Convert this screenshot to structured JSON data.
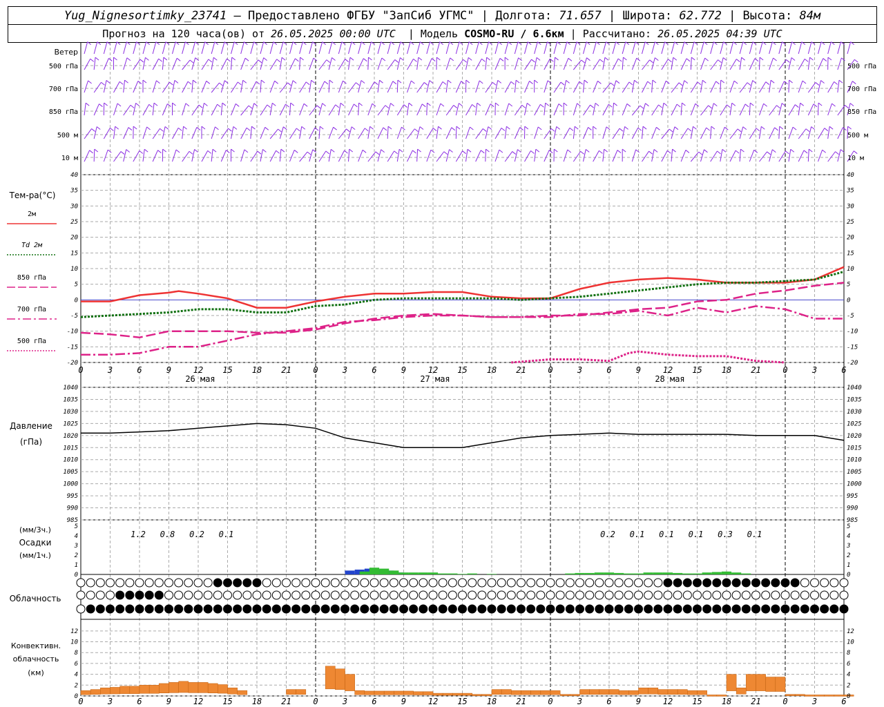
{
  "header": {
    "station": "Yug_Nignesortimky_23741",
    "dash": "—",
    "provider": "Предоставлено ФГБУ \"ЗапСиб УГМС\"",
    "lon_label": "Долгота:",
    "lon": "71.657",
    "lat_label": "Широта:",
    "lat": "62.772",
    "alt_label": "Высота:",
    "alt": "84м",
    "forecast_prefix": "Прогноз на 120 часа(ов) от",
    "forecast_time": "26.05.2025 00:00 UTC",
    "model_label": "Модель",
    "model": "COSMO-RU / 6.6км",
    "calc_label": "Рассчитано:",
    "calc_time": "26.05.2025 04:39 UTC"
  },
  "colors": {
    "wind": "#8a2be2",
    "t2m": "#ee3333",
    "td2m": "#107010",
    "t850": "#dd2288",
    "t700": "#dd2288",
    "t500": "#dd2288",
    "pressure": "#000000",
    "precip3h": "#2244cc",
    "precip1h": "#33bb33",
    "convective": "#ee8833",
    "grid": "#aaaaaa"
  },
  "x_axis": {
    "hour_labels": [
      "0",
      "3",
      "6",
      "9",
      "12",
      "15",
      "18",
      "21",
      "0",
      "3",
      "6",
      "9",
      "12",
      "15",
      "18",
      "21",
      "0",
      "3",
      "6",
      "9",
      "12",
      "15",
      "18",
      "21",
      "0",
      "3",
      "6"
    ],
    "date_labels": [
      "26 мая",
      "27 мая",
      "28 мая"
    ]
  },
  "wind_panel": {
    "title": "Ветер",
    "levels": [
      "500 гПа",
      "700 гПа",
      "850 гПа",
      "500 м",
      "10  м"
    ],
    "levels_right": [
      "500 гПа",
      "700 гПа",
      "850 гПа",
      "500 м",
      "10  м"
    ]
  },
  "temp_panel": {
    "title": "Тем-ра(°C)",
    "legend": [
      "2м",
      "Td  2м",
      "850 гПа",
      "700 гПа",
      "500 гПа"
    ],
    "y_ticks": [
      "40",
      "35",
      "30",
      "25",
      "20",
      "15",
      "10",
      "5",
      "0",
      "-5",
      "-10",
      "-15",
      "-20"
    ]
  },
  "pressure_panel": {
    "title": "Давление",
    "unit": "(гПа)",
    "y_ticks": [
      "1040",
      "1035",
      "1030",
      "1025",
      "1020",
      "1015",
      "1010",
      "1005",
      "1000",
      "995",
      "990",
      "985"
    ]
  },
  "precip_panel": {
    "unit3h": "(мм/3ч.)",
    "title": "Осадки",
    "unit1h": "(мм/1ч.)",
    "y_ticks": [
      "5",
      "4",
      "3",
      "2",
      "1",
      "0"
    ],
    "totals": [
      {
        "hour": 6,
        "value": "1.2"
      },
      {
        "hour": 9,
        "value": "0.8"
      },
      {
        "hour": 12,
        "value": "0.2"
      },
      {
        "hour": 15,
        "value": "0.1"
      },
      {
        "hour": 54,
        "value": "0.2"
      },
      {
        "hour": 57,
        "value": "0.1"
      },
      {
        "hour": 60,
        "value": "0.1"
      },
      {
        "hour": 63,
        "value": "0.1"
      },
      {
        "hour": 66,
        "value": "0.3"
      },
      {
        "hour": 69,
        "value": "0.1"
      }
    ]
  },
  "cloud_panel": {
    "title": "Облачность",
    "rows": [
      "000000000000000000000000000000000000000000888888888888800000000000000000000000000000000000000000000000000000000000000000000000000000000000000000000000000000000000000000000000000008888888888888888888888888888888888888888888000000000000000000000",
      "00000000000888888888888880000000000000000000000000000000000000000000000000000000000000000000000000000000000000000000000000000000000000000000000000000000000000000000000000000000000000000000000000000000000000000000000000000000000000000000000000",
      "00088888888888888888888888888888888888888888888888888888888888888888888888888888888888888888888888888888888888888888888888888888888888888888888888888888888888888888888888888888888888888888888888888888888888888888888888888888888888888888888888"
    ]
  },
  "conv_panel": {
    "title1": "Конвективн.",
    "title2": "облачность",
    "unit": "(км)",
    "y_ticks": [
      "12",
      "10",
      "8",
      "6",
      "4",
      "2",
      "0"
    ]
  },
  "chart_data": [
    {
      "type": "line",
      "name": "temperature",
      "x_unit": "hours from 26.05.2025 00:00 UTC",
      "ylim": [
        -20,
        40
      ],
      "series": [
        {
          "name": "2м",
          "x": [
            0,
            3,
            6,
            9,
            10,
            12,
            15,
            18,
            21,
            24,
            27,
            30,
            33,
            36,
            39,
            42,
            45,
            48,
            51,
            54,
            57,
            60,
            63,
            66,
            69,
            72,
            75,
            78
          ],
          "y": [
            -0.5,
            -0.5,
            1.5,
            2.3,
            2.8,
            2,
            0.5,
            -2.5,
            -2.5,
            -0.5,
            1,
            2,
            2,
            2.5,
            2.5,
            1,
            0.5,
            0.5,
            3.5,
            5.5,
            6.5,
            7,
            6.5,
            5.5,
            5.5,
            5.5,
            6.5,
            10.5
          ]
        },
        {
          "name": "Td  2м",
          "x": [
            0,
            3,
            6,
            9,
            12,
            15,
            18,
            21,
            24,
            27,
            30,
            33,
            36,
            39,
            42,
            45,
            48,
            51,
            54,
            57,
            60,
            63,
            66,
            69,
            72,
            75,
            78
          ],
          "y": [
            -5.5,
            -5,
            -4.5,
            -4,
            -3,
            -3,
            -4,
            -4,
            -2,
            -1.5,
            0,
            0.5,
            0.5,
            0.5,
            0.5,
            0,
            0.5,
            1,
            2,
            3,
            4,
            5,
            5.5,
            5.5,
            6,
            6.5,
            9
          ]
        },
        {
          "name": "850 гПа",
          "x": [
            0,
            3,
            6,
            9,
            12,
            15,
            18,
            21,
            24,
            27,
            30,
            33,
            36,
            39,
            42,
            45,
            48,
            51,
            54,
            57,
            60,
            63,
            66,
            69,
            72,
            75,
            78
          ],
          "y": [
            -10.5,
            -11,
            -12,
            -10,
            -10,
            -10,
            -10.5,
            -10.5,
            -9.5,
            -7.5,
            -6,
            -5,
            -4.5,
            -5,
            -5.5,
            -5.5,
            -5,
            -5,
            -4,
            -3,
            -2.5,
            -0.5,
            0,
            2,
            3,
            4.5,
            5.5
          ]
        },
        {
          "name": "700 гПа",
          "x": [
            0,
            3,
            6,
            9,
            12,
            15,
            18,
            21,
            24,
            27,
            30,
            33,
            36,
            39,
            42,
            45,
            48,
            51,
            54,
            57,
            60,
            63,
            66,
            69,
            72,
            75,
            78
          ],
          "y": [
            -17.5,
            -17.5,
            -17,
            -15,
            -15,
            -13,
            -11,
            -10,
            -9,
            -7,
            -6.5,
            -5.5,
            -5,
            -5,
            -5.5,
            -5.5,
            -5.5,
            -4.5,
            -4.5,
            -3.5,
            -5,
            -2.5,
            -4,
            -2,
            -3,
            -6,
            -6
          ]
        },
        {
          "name": "500 гПа",
          "x": [
            44,
            48,
            51,
            54,
            56,
            57,
            60,
            63,
            66,
            69,
            72
          ],
          "y": [
            -20,
            -19,
            -19,
            -19.5,
            -17,
            -16.5,
            -17.5,
            -18,
            -18,
            -19.5,
            -20
          ]
        }
      ]
    },
    {
      "type": "line",
      "name": "pressure",
      "ylim": [
        985,
        1040
      ],
      "series": [
        {
          "name": "Давление",
          "x": [
            0,
            3,
            6,
            9,
            12,
            15,
            18,
            21,
            24,
            27,
            30,
            33,
            36,
            39,
            42,
            45,
            48,
            51,
            54,
            57,
            60,
            63,
            66,
            69,
            72,
            75,
            78
          ],
          "y": [
            1021,
            1021,
            1021.5,
            1022,
            1023,
            1024,
            1025,
            1024.5,
            1023,
            1019,
            1017,
            1015,
            1015,
            1015,
            1017,
            1019,
            1020,
            1020.5,
            1021,
            1020.5,
            1020.5,
            1020.5,
            1020.5,
            1020,
            1020,
            1020,
            1018
          ]
        }
      ]
    },
    {
      "type": "bar",
      "name": "precipitation",
      "ylim": [
        0,
        5
      ],
      "series": [
        {
          "name": "(мм/3ч.)",
          "x": [
            27.5,
            28.5,
            29.5,
            30.5,
            31.5,
            32.5
          ],
          "y": [
            0.4,
            0.5,
            0.6,
            0.5,
            0.4,
            0.2
          ]
        },
        {
          "name": "(мм/1ч.)",
          "x": [
            29,
            30,
            31,
            32,
            33,
            34,
            35,
            36,
            37,
            38,
            39,
            40,
            42,
            50,
            51,
            52,
            53,
            54,
            55,
            56,
            57,
            58,
            59,
            60,
            61,
            62,
            63,
            64,
            65,
            66,
            67,
            68
          ],
          "y": [
            0.3,
            0.7,
            0.6,
            0.4,
            0.2,
            0.2,
            0.2,
            0.2,
            0.1,
            0.1,
            0.05,
            0.1,
            0.05,
            0.1,
            0.15,
            0.15,
            0.2,
            0.2,
            0.15,
            0.1,
            0.1,
            0.2,
            0.2,
            0.2,
            0.15,
            0.1,
            0.1,
            0.2,
            0.25,
            0.3,
            0.2,
            0.1
          ]
        }
      ]
    },
    {
      "type": "bar",
      "name": "convective cloud",
      "ylim": [
        0,
        13
      ],
      "series": [
        {
          "name": "(км)",
          "x": [
            0,
            1,
            2,
            3,
            4,
            5,
            6,
            7,
            8,
            9,
            10,
            11,
            12,
            13,
            14,
            15,
            16,
            17,
            18,
            19,
            20,
            21,
            22,
            23,
            24,
            25,
            26,
            27,
            28,
            29,
            30,
            31,
            32,
            33,
            34,
            35,
            36,
            37,
            38,
            39,
            40,
            41,
            42,
            43,
            44,
            45,
            46,
            47,
            48,
            49,
            50,
            51,
            52,
            53,
            54,
            55,
            56,
            57,
            58,
            59,
            60,
            61,
            62,
            63,
            64,
            65,
            66,
            67,
            68,
            69,
            70,
            71,
            72,
            73,
            74,
            75,
            76,
            77,
            78
          ],
          "y": [
            1,
            1.2,
            1.5,
            1.6,
            1.8,
            1.8,
            2,
            2,
            2.3,
            2.5,
            2.7,
            2.5,
            2.5,
            2.3,
            2.1,
            1.5,
            1,
            0,
            0,
            0,
            0,
            1.2,
            1.2,
            0,
            0,
            5.5,
            5,
            4,
            1,
            0.9,
            0.9,
            0.9,
            0.9,
            0.9,
            0.8,
            0.8,
            0.5,
            0.5,
            0.5,
            0.5,
            0.3,
            0.3,
            1.2,
            1.2,
            1,
            1,
            1,
            1,
            1,
            0.3,
            0.3,
            1.2,
            1.2,
            1.2,
            1.2,
            1,
            1,
            1.5,
            1.5,
            1.2,
            1.2,
            1.2,
            1,
            1,
            0.2,
            0.2,
            4,
            1.5,
            4,
            4,
            3.5,
            3.5,
            0.3,
            0.3,
            0.2,
            0.2,
            0.2,
            0.2,
            0.2
          ]
        }
      ]
    }
  ]
}
